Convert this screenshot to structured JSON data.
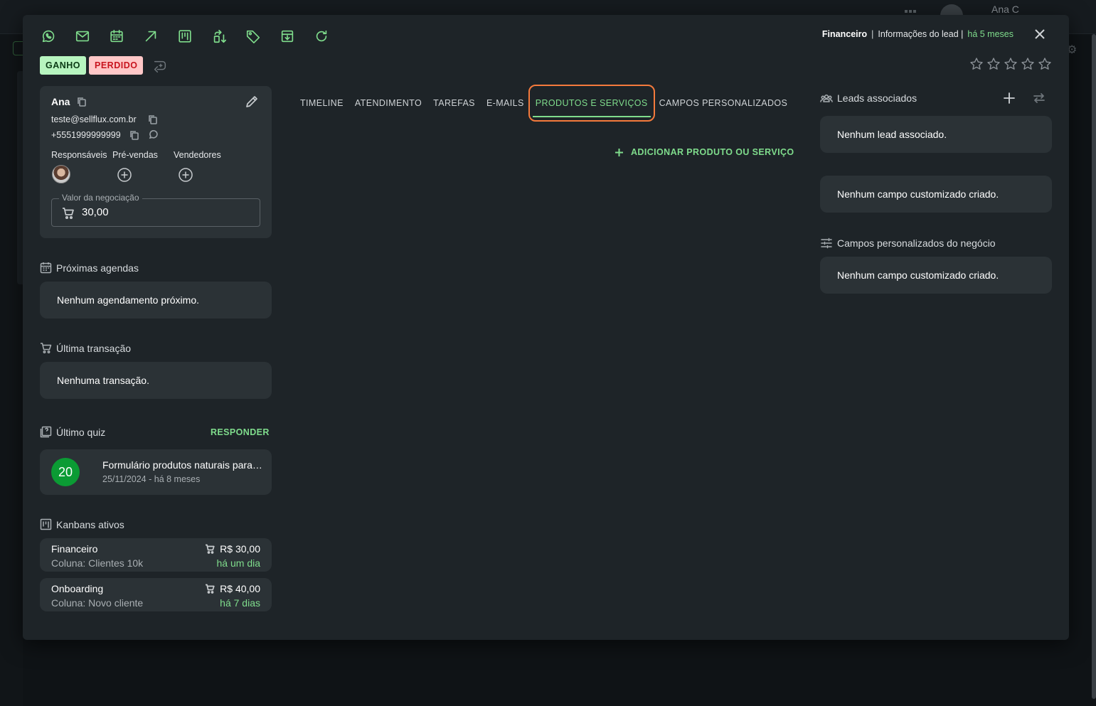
{
  "background": {
    "user_name": "Ana C"
  },
  "toolbar": {
    "icons": [
      "whatsapp-icon",
      "mail-icon",
      "calendar-icon",
      "arrow-up-right-icon",
      "kanban-icon",
      "transfer-icon",
      "tag-icon",
      "archive-icon",
      "refresh-icon"
    ]
  },
  "breadcrumb": {
    "pipeline": "Financeiro",
    "section": "Informações do lead |",
    "time": "há 5 meses"
  },
  "status": {
    "won": "GANHO",
    "lost": "PERDIDO"
  },
  "rating": {
    "stars": 5,
    "value": 0
  },
  "contact": {
    "name": "Ana",
    "email": "teste@sellflux.com.br",
    "phone": "+5551999999999",
    "roles": {
      "responsaveis": "Responsáveis",
      "pre_vendas": "Pré-vendas",
      "vendedores": "Vendedores"
    },
    "value_label": "Valor da negociação",
    "value": "30,00"
  },
  "agenda": {
    "title": "Próximas agendas",
    "empty": "Nenhum agendamento próximo."
  },
  "transaction": {
    "title": "Última transação",
    "empty": "Nenhuma transação."
  },
  "quiz": {
    "title": "Último quiz",
    "respond": "RESPONDER",
    "score": "20",
    "name": "Formulário produtos naturais para emagrecer",
    "date": "25/11/2024 - há 8 meses"
  },
  "kanbans": {
    "title": "Kanbans ativos",
    "items": [
      {
        "name": "Financeiro",
        "column": "Coluna: Clientes 10k",
        "value": "R$ 30,00",
        "time": "há um dia"
      },
      {
        "name": "Onboarding",
        "column": "Coluna: Novo cliente",
        "value": "R$ 40,00",
        "time": "há 7 dias"
      }
    ]
  },
  "tabs": [
    {
      "label": "TIMELINE"
    },
    {
      "label": "ATENDIMENTO"
    },
    {
      "label": "TAREFAS"
    },
    {
      "label": "E-MAILS"
    },
    {
      "label": "PRODUTOS E SERVIÇOS",
      "active": true
    },
    {
      "label": "CAMPOS PERSONALIZADOS"
    }
  ],
  "products": {
    "add_label": "ADICIONAR PRODUTO OU SERVIÇO"
  },
  "associated": {
    "title": "Leads associados",
    "empty": "Nenhum lead associado."
  },
  "custom_fields": {
    "empty": "Nenhum campo customizado criado."
  },
  "business_fields": {
    "title": "Campos personalizados do negócio",
    "empty": "Nenhum campo customizado criado."
  },
  "colors": {
    "accent": "#7fdc8c",
    "won_bg": "#b7f5bf",
    "lost_bg": "#ffc7c7",
    "focus_ring": "#f47a3c"
  }
}
